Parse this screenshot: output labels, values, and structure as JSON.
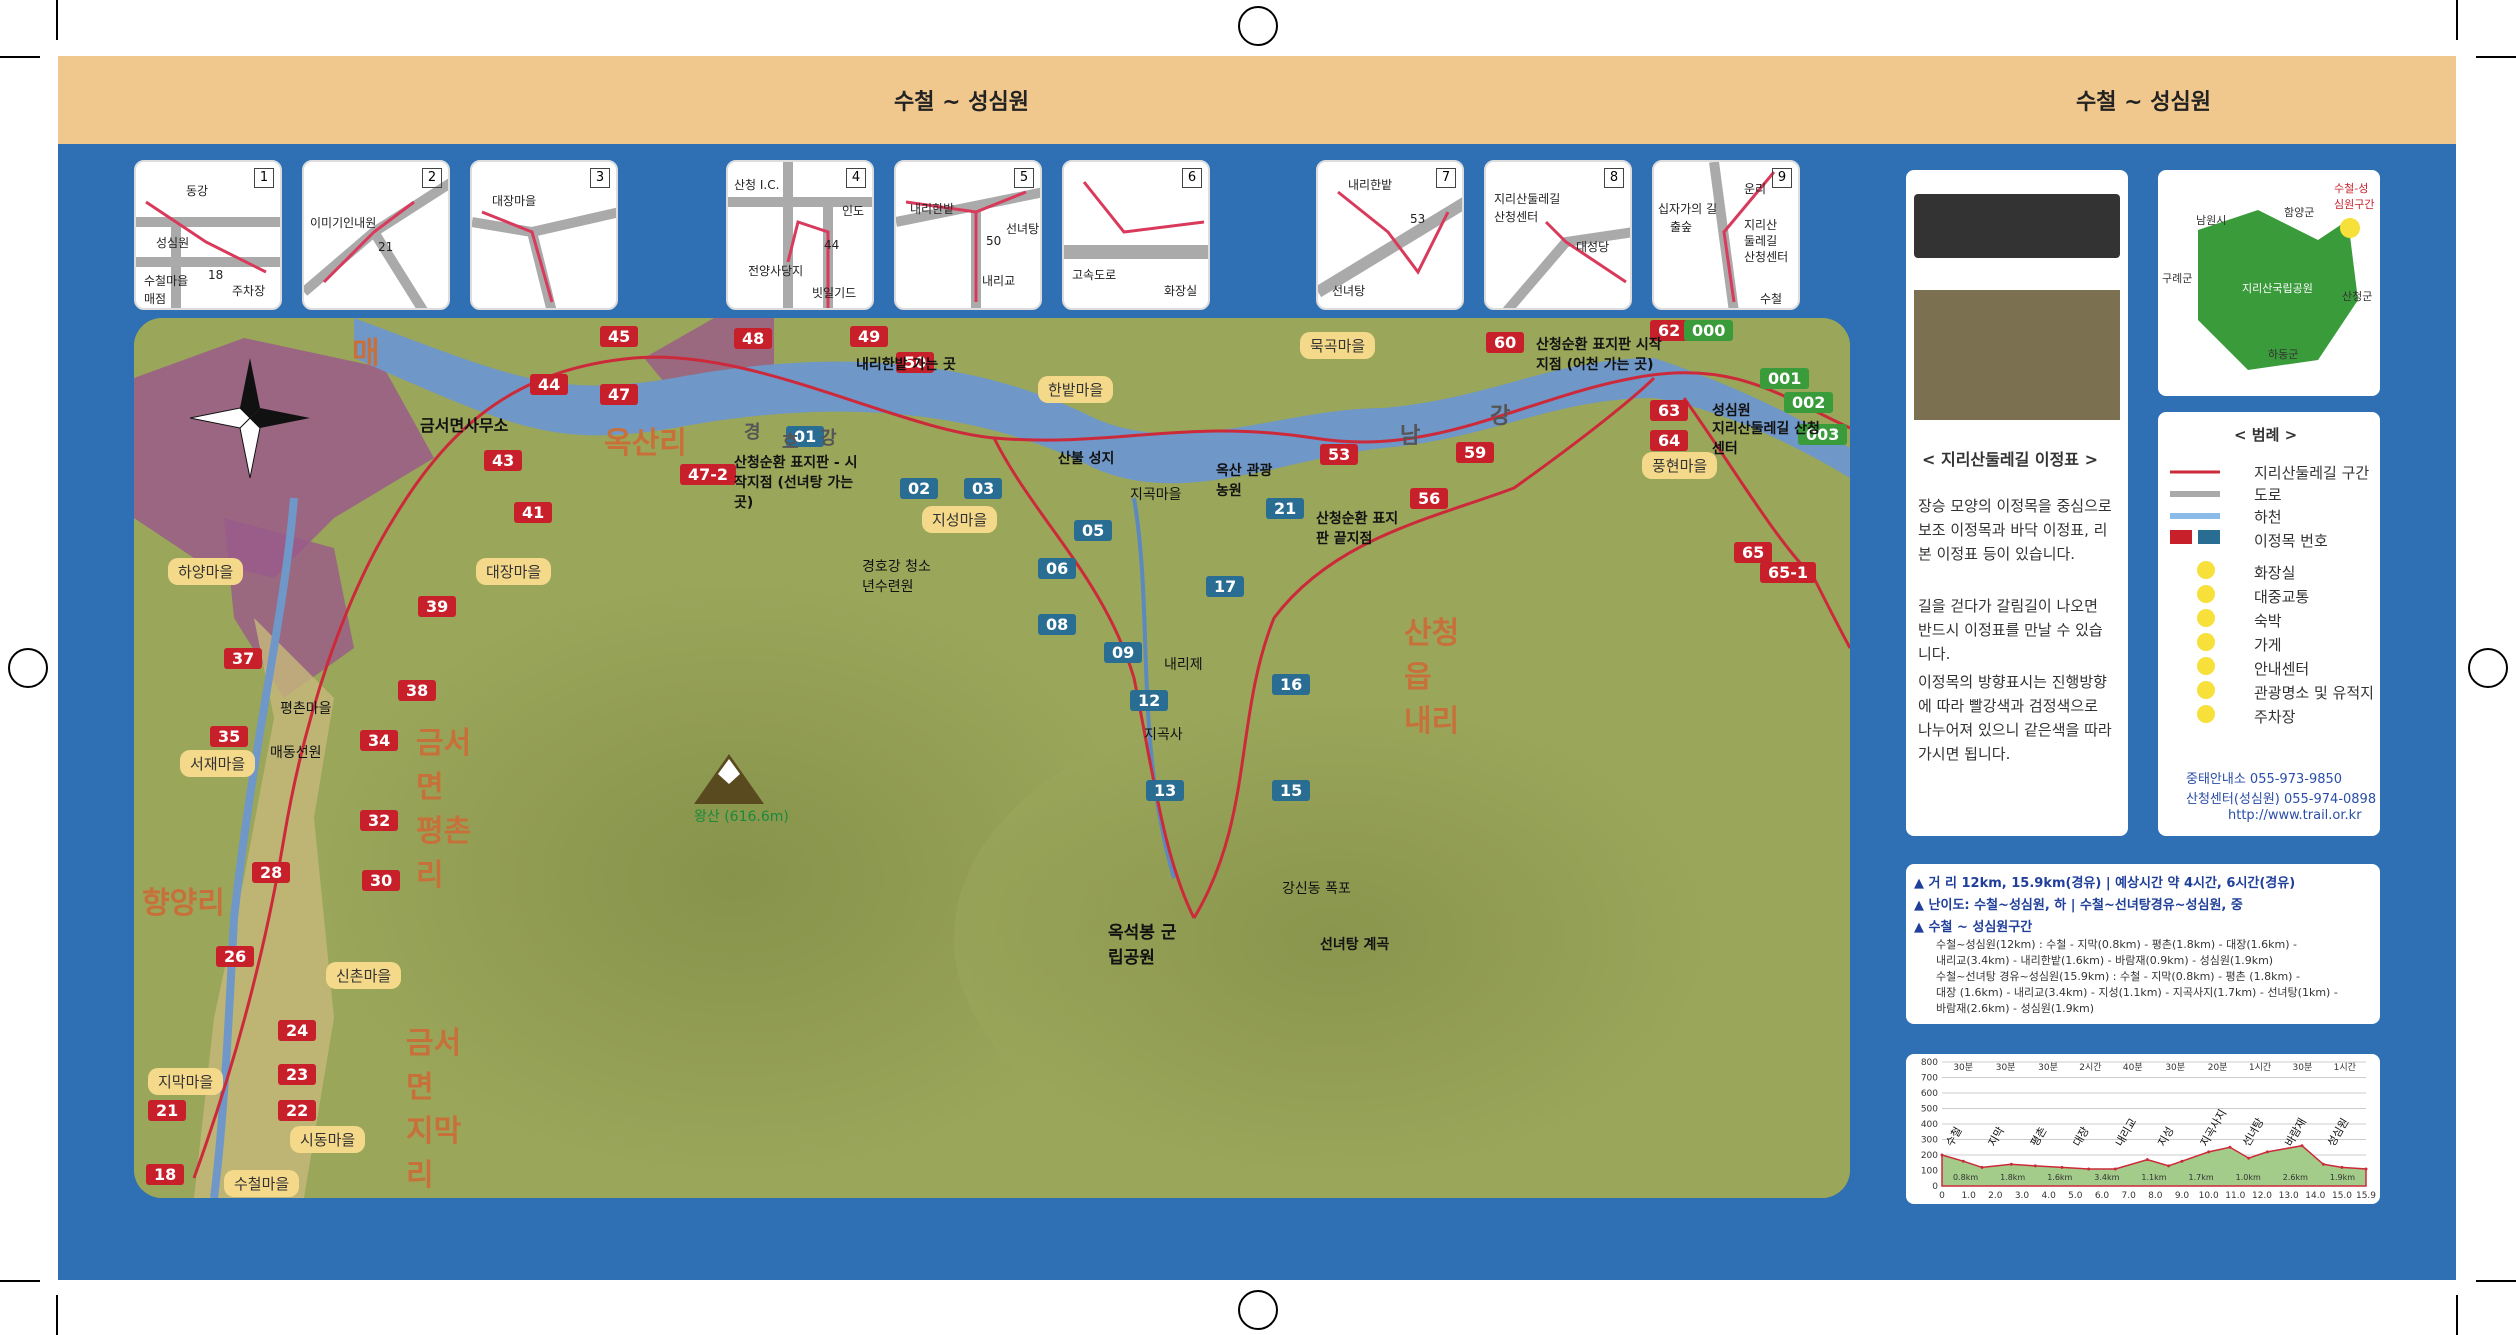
{
  "header": {
    "left_title": "수철 ~ 성심원",
    "right_title": "수철 ~ 성심원"
  },
  "insets": [
    {
      "num": "1",
      "labels": [
        "동강",
        "성심원",
        "수철마을",
        "매점",
        "주차장",
        "18"
      ]
    },
    {
      "num": "2",
      "labels": [
        "이미기인내원",
        "21"
      ]
    },
    {
      "num": "3",
      "labels": [
        "대장마을"
      ]
    },
    {
      "num": "4",
      "labels": [
        "산청 I.C.",
        "인도",
        "44",
        "빗일기드",
        "전양사당지"
      ]
    },
    {
      "num": "5",
      "labels": [
        "내리한밭",
        "50",
        "선녀탕",
        "내리교"
      ]
    },
    {
      "num": "6",
      "labels": [
        "고속도로",
        "화장실"
      ]
    },
    {
      "num": "7",
      "labels": [
        "내리한밭",
        "53",
        "선녀탕"
      ]
    },
    {
      "num": "8",
      "labels": [
        "지리산둘레길",
        "산청센터",
        "대성당"
      ]
    },
    {
      "num": "9",
      "labels": [
        "십자가의 길",
        "출숲",
        "운리",
        "지리산",
        "둘레길",
        "산청센터",
        "수철"
      ]
    }
  ],
  "map": {
    "markers_red": [
      "18",
      "21",
      "22",
      "23",
      "24",
      "26",
      "28",
      "30",
      "32",
      "34",
      "35",
      "37",
      "38",
      "39",
      "41",
      "43",
      "44",
      "45",
      "47",
      "47-2",
      "48",
      "49",
      "50",
      "53",
      "56",
      "59",
      "60",
      "62",
      "63",
      "64",
      "65",
      "65-1"
    ],
    "markers_teal": [
      "01",
      "02",
      "03",
      "05",
      "06",
      "08",
      "09",
      "12",
      "13",
      "15",
      "16",
      "17",
      "21"
    ],
    "markers_green": [
      "000",
      "001",
      "002",
      "003"
    ],
    "places": [
      "하양마을",
      "대장마을",
      "서재마을",
      "신촌마을",
      "지막마을",
      "시동마을",
      "수철마을",
      "지성마을",
      "한밭마을",
      "묵곡마을",
      "풍현마을"
    ],
    "labels": [
      "금서면사무소",
      "산청순환 표지판 - 시작지점 (선녀탕 가는 곳)",
      "내리한밭 가는 곳",
      "지곡마을",
      "옥산 관광농원",
      "산청순환 표지판 끝지점",
      "성심원",
      "지리산둘레길 산청센터",
      "산청순환 표지판 시작지점 (어천 가는 곳)",
      "왕산 (616.6m)",
      "옥석봉 군립공원",
      "산불 성지",
      "내리제",
      "지곡사",
      "평촌마을",
      "매동선원",
      "경호강 청소년수련원",
      "강신동 폭포",
      "선녀탕 계곡",
      "남",
      "강",
      "경",
      "호",
      "강",
      "금서면 평촌리",
      "산청읍 내리",
      "향양리",
      "금서면 지막리",
      "매",
      "옥산리"
    ]
  },
  "sign_panel": {
    "title": "< 지리산둘레길 이정표 >",
    "p1": "장승 모양의 이정목을 중심으로 보조 이정목과 바닥 이정표, 리본 이정표 등이 있습니다.",
    "p2": "길을 걷다가 갈림길이 나오면 반드시 이정표를 만날 수 있습니다.",
    "p3": "이정목의 방향표시는 진행방향에 따라 빨강색과 검정색으로 나누어져 있으니 같은색을 따라 가시면 됩니다."
  },
  "overview": {
    "labels": [
      "남원시",
      "함양군",
      "수철-성심원구간",
      "구례군",
      "지리산국립공원",
      "산청군",
      "하동군"
    ]
  },
  "legend": {
    "title": "< 범례 >",
    "items": [
      "지리산둘레길 구간",
      "도로",
      "하천",
      "이정목 번호",
      "화장실",
      "대중교통",
      "숙박",
      "가게",
      "안내센터",
      "관광명소 및 유적지",
      "주차장"
    ],
    "contacts": [
      "중태안내소 055-973-9850",
      "산청센터(성심원) 055-974-0898",
      "http://www.trail.or.kr"
    ]
  },
  "info": {
    "dist": "▲ 거 리 12km, 15.9km(경유) | 예상시간 약 4시간, 6시간(경유)",
    "diff": "▲ 난이도: 수철~성심원, 하 | 수철~선녀탕경유~성심원, 중",
    "sec": "▲ 수철 ~ 성심원구간",
    "r1": "수철~성심원(12km) : 수철 - 지막(0.8km) - 평촌(1.8km) - 대장(1.6km) -",
    "r2": "내리교(3.4km) - 내리한밭(1.6km) - 바람재(0.9km) - 성심원(1.9km)",
    "r3": "수철~선녀탕 경유~성심원(15.9km) : 수철 - 지막(0.8km) - 평촌 (1.8km) -",
    "r4": "대장 (1.6km) - 내리교(3.4km) - 지성(1.1km) - 지곡사지(1.7km) - 선녀탕(1km) -",
    "r5": "바람재(2.6km) - 성심원(1.9km)"
  },
  "chart_data": {
    "type": "area",
    "title": "",
    "xlabel": "",
    "ylabel": "",
    "ylim": [
      0,
      800
    ],
    "xlim": [
      0,
      15.9
    ],
    "y_ticks": [
      0,
      100,
      200,
      300,
      400,
      500,
      600,
      700,
      800
    ],
    "x_ticks": [
      "0",
      "1.0",
      "2.0",
      "3.0",
      "4.0",
      "5.0",
      "6.0",
      "7.0",
      "8.0",
      "9.0",
      "10.0",
      "11.0",
      "12.0",
      "13.0",
      "14.0",
      "15.0",
      "15.9"
    ],
    "x": [
      0,
      0.8,
      1.5,
      2.6,
      3.5,
      4.5,
      5.5,
      6.5,
      7.7,
      8.5,
      9.0,
      10.0,
      10.8,
      11.5,
      12.2,
      13.5,
      14.3,
      15.0,
      15.9
    ],
    "y": [
      200,
      160,
      120,
      140,
      130,
      120,
      110,
      110,
      170,
      130,
      160,
      220,
      250,
      180,
      220,
      260,
      140,
      120,
      110
    ],
    "time_labels": [
      "30분",
      "30분",
      "30분",
      "2시간",
      "40분",
      "30분",
      "20분",
      "1시간",
      "30분",
      "1시간"
    ],
    "place_labels": [
      "수철",
      "지막",
      "평촌",
      "대장",
      "내리교",
      "지성",
      "지곡사지",
      "선녀탕",
      "바람재",
      "성심원"
    ],
    "segment_labels": [
      "0.8km",
      "1.8km",
      "1.6km",
      "3.4km",
      "1.1km",
      "1.7km",
      "1.0km",
      "2.6km",
      "1.9km"
    ]
  }
}
